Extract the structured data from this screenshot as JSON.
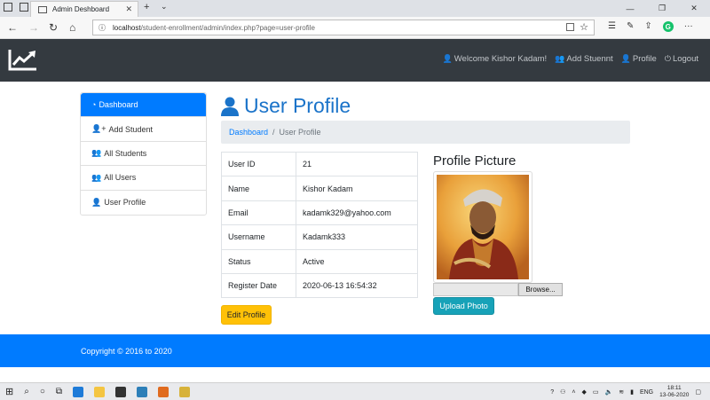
{
  "browser": {
    "tab_title": "Admin Deshboard",
    "url_host": "localhost",
    "url_path": "/student-enrollment/admin/index.php?page=user-profile"
  },
  "navbar": {
    "welcome": "Welcome Kishor Kadam!",
    "add_student": "Add Stuennt",
    "profile": "Profile",
    "logout": "Logout"
  },
  "sidebar": {
    "items": [
      {
        "label": "Dashboard",
        "icon": "dashboard-icon",
        "active": true
      },
      {
        "label": "Add Student",
        "icon": "user-plus-icon"
      },
      {
        "label": "All Students",
        "icon": "users-icon"
      },
      {
        "label": "All Users",
        "icon": "users-icon"
      },
      {
        "label": "User Profile",
        "icon": "user-icon"
      }
    ]
  },
  "main": {
    "title": "User Profile",
    "breadcrumb": {
      "home": "Dashboard",
      "current": "User Profile"
    },
    "profile": [
      {
        "key": "User ID",
        "value": "21"
      },
      {
        "key": "Name",
        "value": "Kishor Kadam"
      },
      {
        "key": "Email",
        "value": "kadamk329@yahoo.com"
      },
      {
        "key": "Username",
        "value": "Kadamk333"
      },
      {
        "key": "Status",
        "value": "Active"
      },
      {
        "key": "Register Date",
        "value": "2020-06-13 16:54:32"
      }
    ],
    "edit_button": "Edit Profile",
    "picture_title": "Profile Picture",
    "browse_label": "Browse...",
    "upload_button": "Upload Photo"
  },
  "footer": {
    "copyright": "Copyright © 2016 to 2020"
  },
  "taskbar": {
    "lang": "ENG",
    "time": "18:11",
    "date": "13-06-2020"
  },
  "colors": {
    "primary": "#007bff",
    "navbar": "#343a40",
    "warning": "#ffc107",
    "info": "#17a2b8",
    "title": "#1a73c9"
  }
}
